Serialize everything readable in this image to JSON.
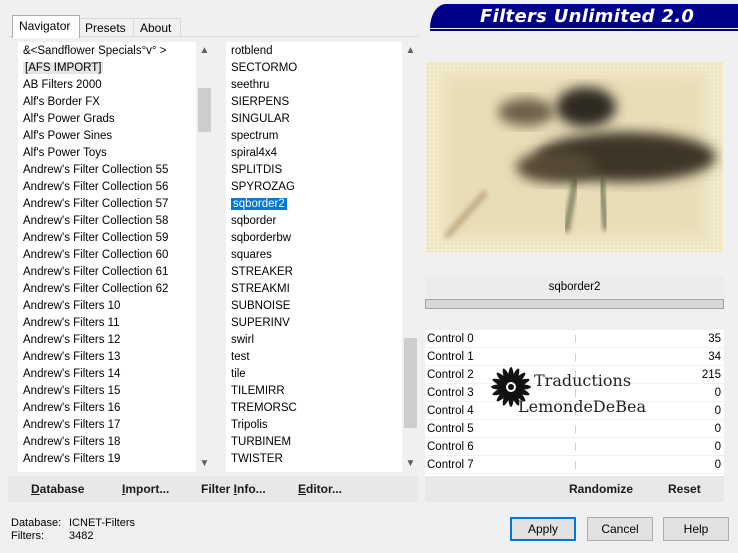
{
  "tabs": [
    {
      "label": "Navigator",
      "active": true
    },
    {
      "label": "Presets",
      "active": false
    },
    {
      "label": "About",
      "active": false
    }
  ],
  "banner": {
    "title": "Filters Unlimited 2.0",
    "color": "#00008b"
  },
  "categories": {
    "items": [
      "&<Sandflower Specials°v° >",
      "[AFS IMPORT]",
      "AB Filters 2000",
      "Alf's Border FX",
      "Alf's Power Grads",
      "Alf's Power Sines",
      "Alf's Power Toys",
      "Andrew's Filter Collection 55",
      "Andrew's Filter Collection 56",
      "Andrew's Filter Collection 57",
      "Andrew's Filter Collection 58",
      "Andrew's Filter Collection 59",
      "Andrew's Filter Collection 60",
      "Andrew's Filter Collection 61",
      "Andrew's Filter Collection 62",
      "Andrew's Filters 10",
      "Andrew's Filters 11",
      "Andrew's Filters 12",
      "Andrew's Filters 13",
      "Andrew's Filters 14",
      "Andrew's Filters 15",
      "Andrew's Filters 16",
      "Andrew's Filters 17",
      "Andrew's Filters 18",
      "Andrew's Filters 19"
    ],
    "highlighted": "[AFS IMPORT]"
  },
  "filters": {
    "items": [
      "rotblend",
      "SECTORMO",
      "seethru",
      "SIERPENS",
      "SINGULAR",
      "spectrum",
      "spiral4x4",
      "SPLITDIS",
      "SPYROZAG",
      "sqborder2",
      "sqborder",
      "sqborderbw",
      "squares",
      "STREAKER",
      "STREAKMI",
      "SUBNOISE",
      "SUPERINV",
      "swirl",
      "test",
      "tile",
      "TILEMIRR",
      "TREMORSC",
      "Tripolis",
      "TURBINEM",
      "TWISTER"
    ],
    "selected": "sqborder2"
  },
  "current_filter": "sqborder2",
  "controls": [
    {
      "label": "Control 0",
      "value": "35"
    },
    {
      "label": "Control 1",
      "value": "34"
    },
    {
      "label": "Control 2",
      "value": "215"
    },
    {
      "label": "Control 3",
      "value": "0"
    },
    {
      "label": "Control 4",
      "value": "0"
    },
    {
      "label": "Control 5",
      "value": "0"
    },
    {
      "label": "Control 6",
      "value": "0"
    },
    {
      "label": "Control 7",
      "value": "0"
    }
  ],
  "watermark": {
    "line1": "Traductions",
    "line2": "LemondeDeBea"
  },
  "toolbar": {
    "database_first": "D",
    "database_rest": "atabase",
    "import_first": "I",
    "import_rest": "mport...",
    "filterinfo_pre": "Filter ",
    "filterinfo_u": "I",
    "filterinfo_post": "nfo...",
    "editor_first": "E",
    "editor_rest": "ditor...",
    "randomize": "Randomize",
    "reset": "Reset"
  },
  "info": {
    "database_label": "Database:",
    "database_value": "ICNET-Filters",
    "filters_label": "Filters:",
    "filters_value": "3482"
  },
  "buttons": {
    "apply": "Apply",
    "cancel": "Cancel",
    "help": "Help"
  }
}
